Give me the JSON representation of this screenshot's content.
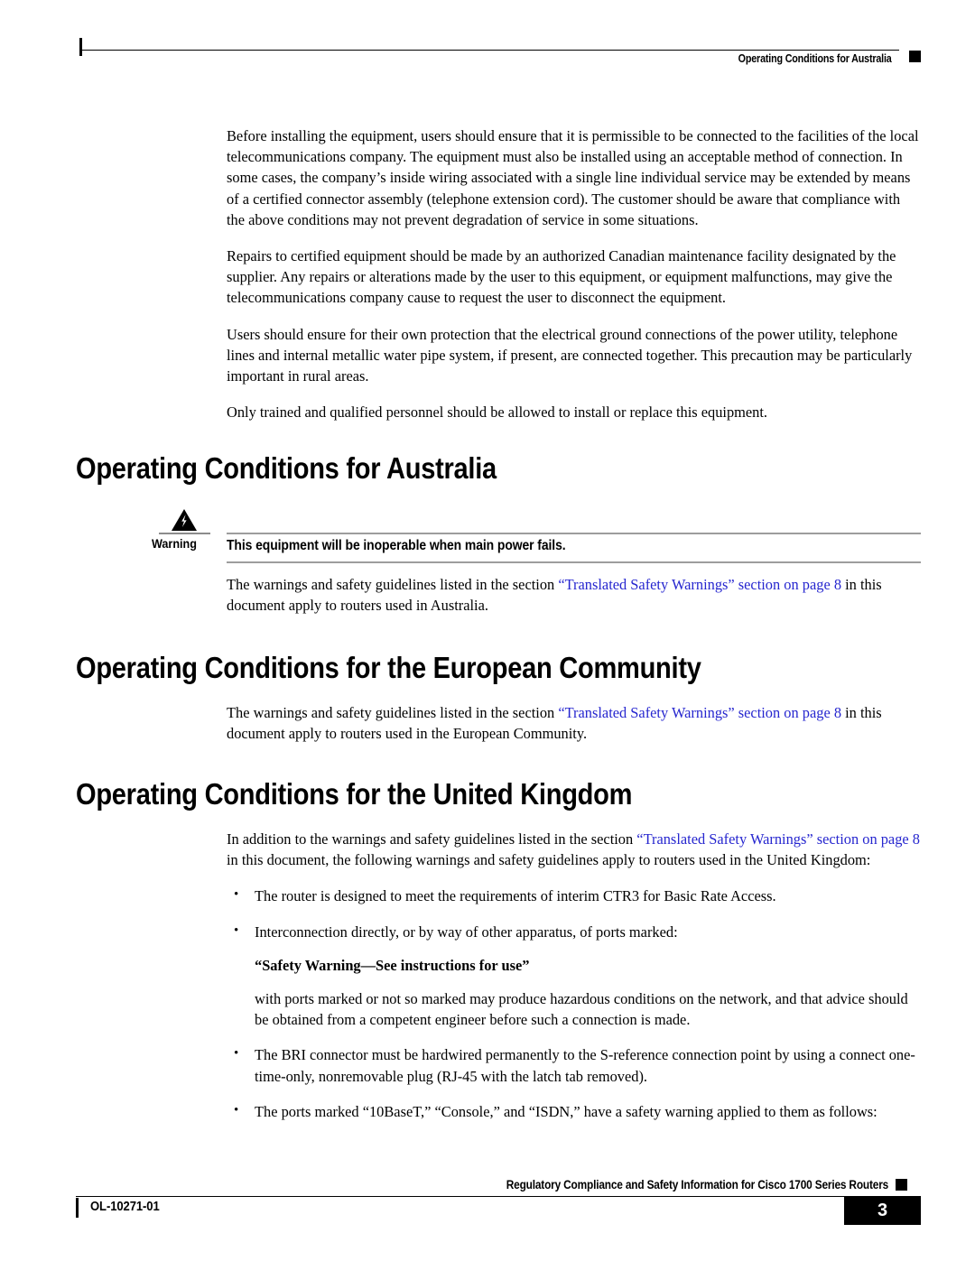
{
  "header": {
    "title": "Operating Conditions for Australia",
    "marker_icon": "black-square-marker"
  },
  "intro": {
    "paragraphs": [
      "Before installing the equipment, users should ensure that it is permissible to be connected to the facilities of the local telecommunications company. The equipment must also be installed using an acceptable method of connection. In some cases, the company’s inside wiring associated with a single line individual service may be extended by means of a certified connector assembly (telephone extension cord). The customer should be aware that compliance with the above conditions may not prevent degradation of service in some situations.",
      "Repairs to certified equipment should be made by an authorized Canadian maintenance facility designated by the supplier. Any repairs or alterations made by the user to this equipment, or equipment malfunctions, may give the telecommunications company cause to request the user to disconnect the equipment.",
      "Users should ensure for their own protection that the electrical ground connections of the power utility, telephone lines and internal metallic water pipe system, if present, are connected together. This precaution may be particularly important in rural areas.",
      "Only trained and qualified personnel should be allowed to install or replace this equipment."
    ]
  },
  "sections": {
    "australia": {
      "heading": "Operating Conditions for Australia",
      "warning": {
        "label": "Warning",
        "icon": "warning-lightning-triangle-icon",
        "text": "This equipment will be inoperable when main power fails."
      },
      "body_before_link": "The warnings and safety guidelines listed in the section ",
      "link_text": "“Translated Safety Warnings” section on page 8",
      "body_after_link": " in this document apply to routers used in Australia."
    },
    "european_community": {
      "heading": "Operating Conditions for the European Community",
      "body_before_link": "The warnings and safety guidelines listed in the section ",
      "link_text": "“Translated Safety Warnings” section on page 8",
      "body_after_link": " in this document apply to routers used in the European Community."
    },
    "united_kingdom": {
      "heading": "Operating Conditions for the United Kingdom",
      "body_before_link": "In addition to the warnings and safety guidelines listed in the section ",
      "link_text": "“Translated Safety Warnings” section on page 8",
      "body_after_link": " in this document, the following warnings and safety guidelines apply to routers used in the United Kingdom:",
      "bullets": [
        {
          "text": "The router is designed to meet the requirements of interim CTR3 for Basic Rate Access."
        },
        {
          "text": "Interconnection directly, or by way of other apparatus, of ports marked:",
          "sub_bold": "“Safety Warning—See instructions for use”",
          "sub_plain": "with ports marked or not so marked may produce hazardous conditions on the network, and that advice should be obtained from a competent engineer before such a connection is made."
        },
        {
          "text": "The BRI connector must be hardwired permanently to the S-reference connection point by using a connect one-time-only, nonremovable plug (RJ-45 with the latch tab removed)."
        },
        {
          "text": "The ports marked “10BaseT,” “Console,” and “ISDN,” have a safety warning applied to them as follows:"
        }
      ]
    }
  },
  "footer": {
    "title": "Regulatory Compliance and Safety Information for Cisco 1700 Series Routers",
    "doc_id": "OL-10271-01",
    "page_number": "3",
    "marker_icon": "black-square-marker"
  },
  "colors": {
    "link": "#2626cf",
    "rule": "#9d9d9d",
    "text": "#000000"
  }
}
